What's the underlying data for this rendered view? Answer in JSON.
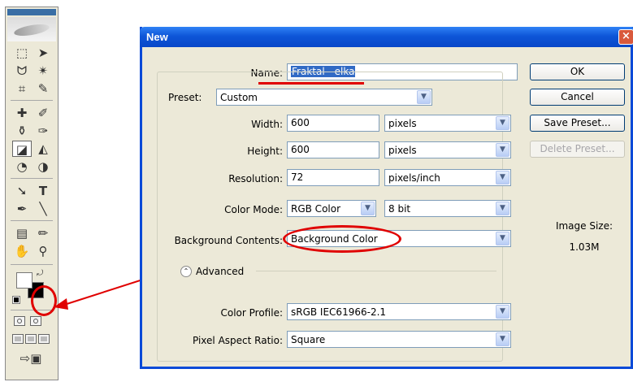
{
  "dialog": {
    "title": "New",
    "close_glyph": "×",
    "name": {
      "label": "Name:",
      "value": "Fraktal - elka"
    },
    "preset": {
      "label": "Preset:",
      "value": "Custom"
    },
    "width": {
      "label": "Width:",
      "value": "600",
      "unit": "pixels"
    },
    "height": {
      "label": "Height:",
      "value": "600",
      "unit": "pixels"
    },
    "resolution": {
      "label": "Resolution:",
      "value": "72",
      "unit": "pixels/inch"
    },
    "color_mode": {
      "label": "Color Mode:",
      "value": "RGB Color",
      "depth": "8 bit"
    },
    "background": {
      "label": "Background Contents:",
      "value": "Background Color"
    },
    "advanced": {
      "label": "Advanced"
    },
    "color_profile": {
      "label": "Color Profile:",
      "value": "sRGB IEC61966-2.1"
    },
    "pixel_aspect": {
      "label": "Pixel Aspect Ratio:",
      "value": "Square"
    },
    "buttons": {
      "ok": "OK",
      "cancel": "Cancel",
      "save_preset": "Save Preset...",
      "delete_preset": "Delete Preset..."
    },
    "image_size": {
      "label": "Image Size:",
      "value": "1.03M"
    }
  },
  "toolbox": {
    "tools": [
      {
        "name": "marquee-tool-icon",
        "glyph": "⬚"
      },
      {
        "name": "move-tool-icon",
        "glyph": "➤"
      },
      {
        "name": "lasso-tool-icon",
        "glyph": "ᗢ"
      },
      {
        "name": "magic-wand-tool-icon",
        "glyph": "✴"
      },
      {
        "name": "crop-tool-icon",
        "glyph": "⌗"
      },
      {
        "name": "slice-tool-icon",
        "glyph": "✎"
      },
      {
        "name": "healing-brush-tool-icon",
        "glyph": "✚"
      },
      {
        "name": "brush-tool-icon",
        "glyph": "✐"
      },
      {
        "name": "clone-stamp-tool-icon",
        "glyph": "⚱"
      },
      {
        "name": "history-brush-tool-icon",
        "glyph": "✑"
      },
      {
        "name": "eraser-tool-icon",
        "glyph": "◪"
      },
      {
        "name": "paint-bucket-tool-icon",
        "glyph": "◭"
      },
      {
        "name": "blur-tool-icon",
        "glyph": "◔"
      },
      {
        "name": "dodge-tool-icon",
        "glyph": "◑"
      },
      {
        "name": "path-selection-tool-icon",
        "glyph": "➘"
      },
      {
        "name": "type-tool-icon",
        "glyph": "T"
      },
      {
        "name": "pen-tool-icon",
        "glyph": "✒"
      },
      {
        "name": "line-tool-icon",
        "glyph": "╲"
      },
      {
        "name": "notes-tool-icon",
        "glyph": "▤"
      },
      {
        "name": "eyedropper-tool-icon",
        "glyph": "✏"
      },
      {
        "name": "hand-tool-icon",
        "glyph": "✋"
      },
      {
        "name": "zoom-tool-icon",
        "glyph": "⚲"
      }
    ]
  },
  "colors": {
    "accent_red": "#e00000",
    "title_blue": "#0e56d8",
    "selection_blue": "#316ac5"
  }
}
